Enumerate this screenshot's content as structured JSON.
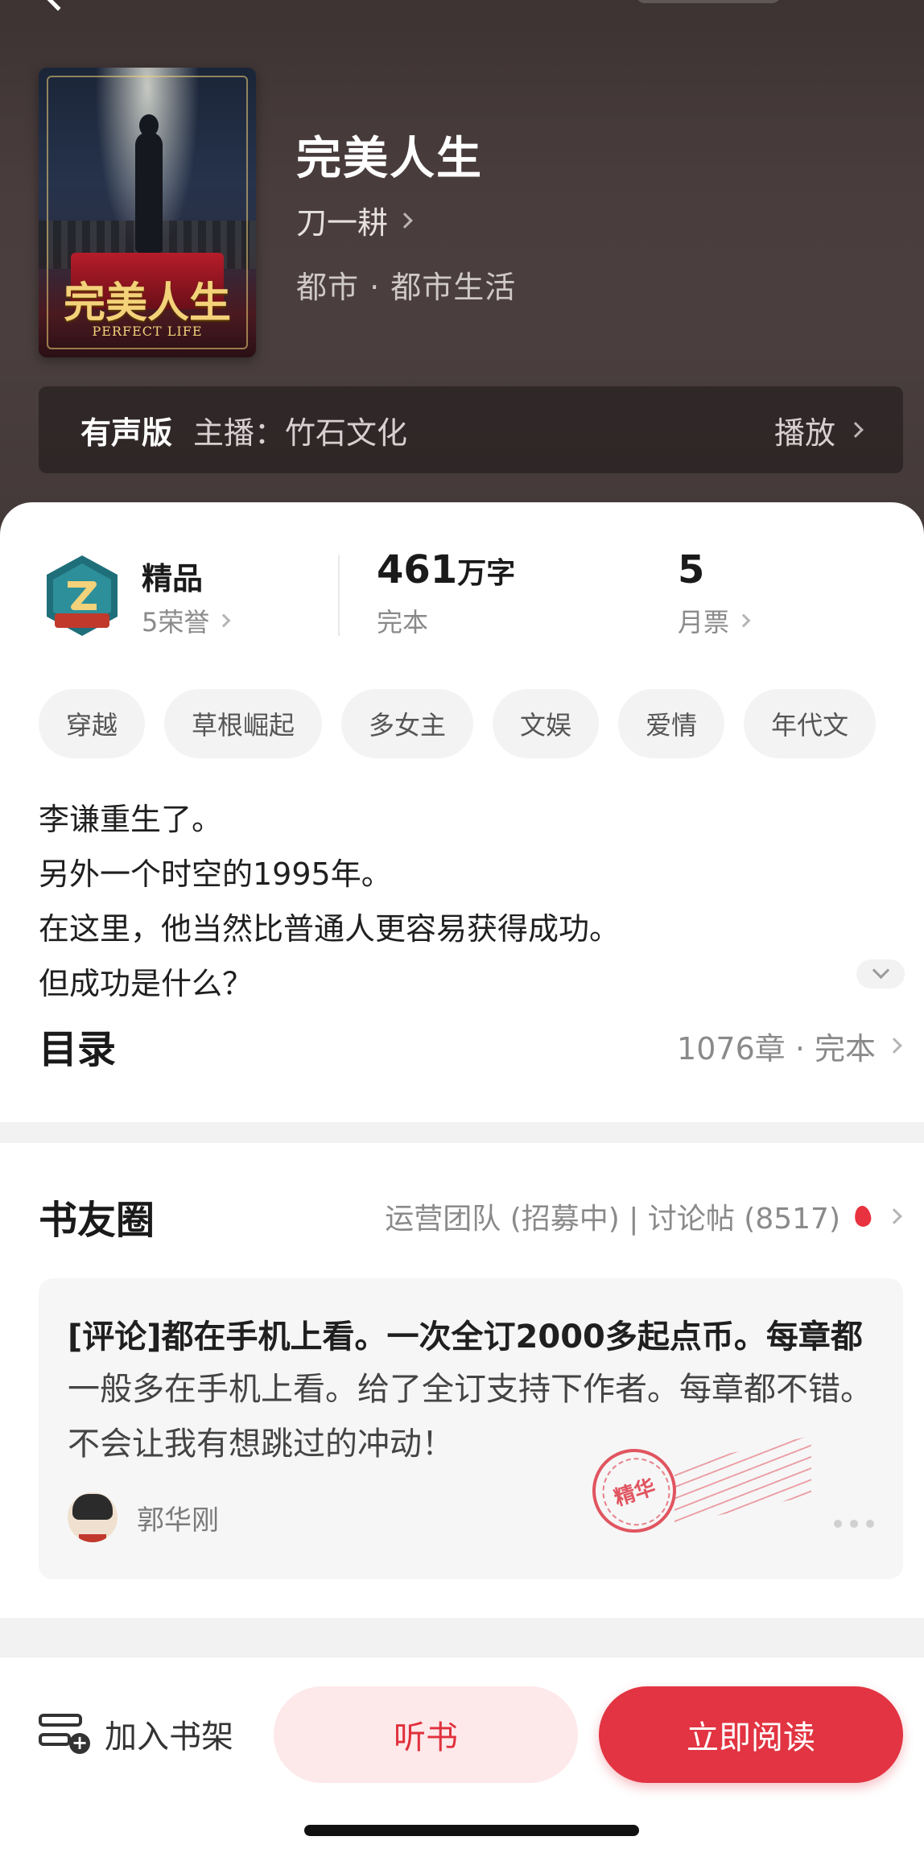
{
  "header": {
    "title": "完美人生",
    "author": "刀一耕",
    "genre": "都市 · 都市生活",
    "cover": {
      "title_text": "完美人生",
      "subtitle_text": "PERFECT LIFE"
    },
    "audio": {
      "label": "有声版",
      "host": "主播：竹石文化",
      "play_label": "播放"
    }
  },
  "stats": {
    "quality": {
      "title": "精品",
      "sub": "5荣誉"
    },
    "words": {
      "number": "461",
      "unit": "万字",
      "sub": "完本"
    },
    "tickets": {
      "number": "5",
      "sub": "月票"
    }
  },
  "tags": [
    "穿越",
    "草根崛起",
    "多女主",
    "文娱",
    "爱情",
    "年代文"
  ],
  "synopsis": {
    "lines": [
      "李谦重生了。",
      "另外一个时空的1995年。",
      "在这里，他当然比普通人更容易获得成功。",
      "但成功是什么？"
    ]
  },
  "toc": {
    "title": "目录",
    "meta": "1076章 · 完本"
  },
  "community": {
    "title": "书友圈",
    "meta": "运营团队 (招募中) | 讨论帖 (8517)",
    "post": {
      "title": "[评论]都在手机上看。一次全订2000多起点币。每章都",
      "body": "一般多在手机上看。给了全订支持下作者。每章都不错。不会让我有想跳过的冲动！",
      "user": "郭华刚",
      "stamp_label": "精华"
    }
  },
  "bottom_bar": {
    "shelf_label": "加入书架",
    "listen_label": "听书",
    "read_label": "立即阅读"
  },
  "colors": {
    "accent": "#e23442",
    "accent_light": "#fde8ea",
    "header_bg": "#463a3a"
  }
}
